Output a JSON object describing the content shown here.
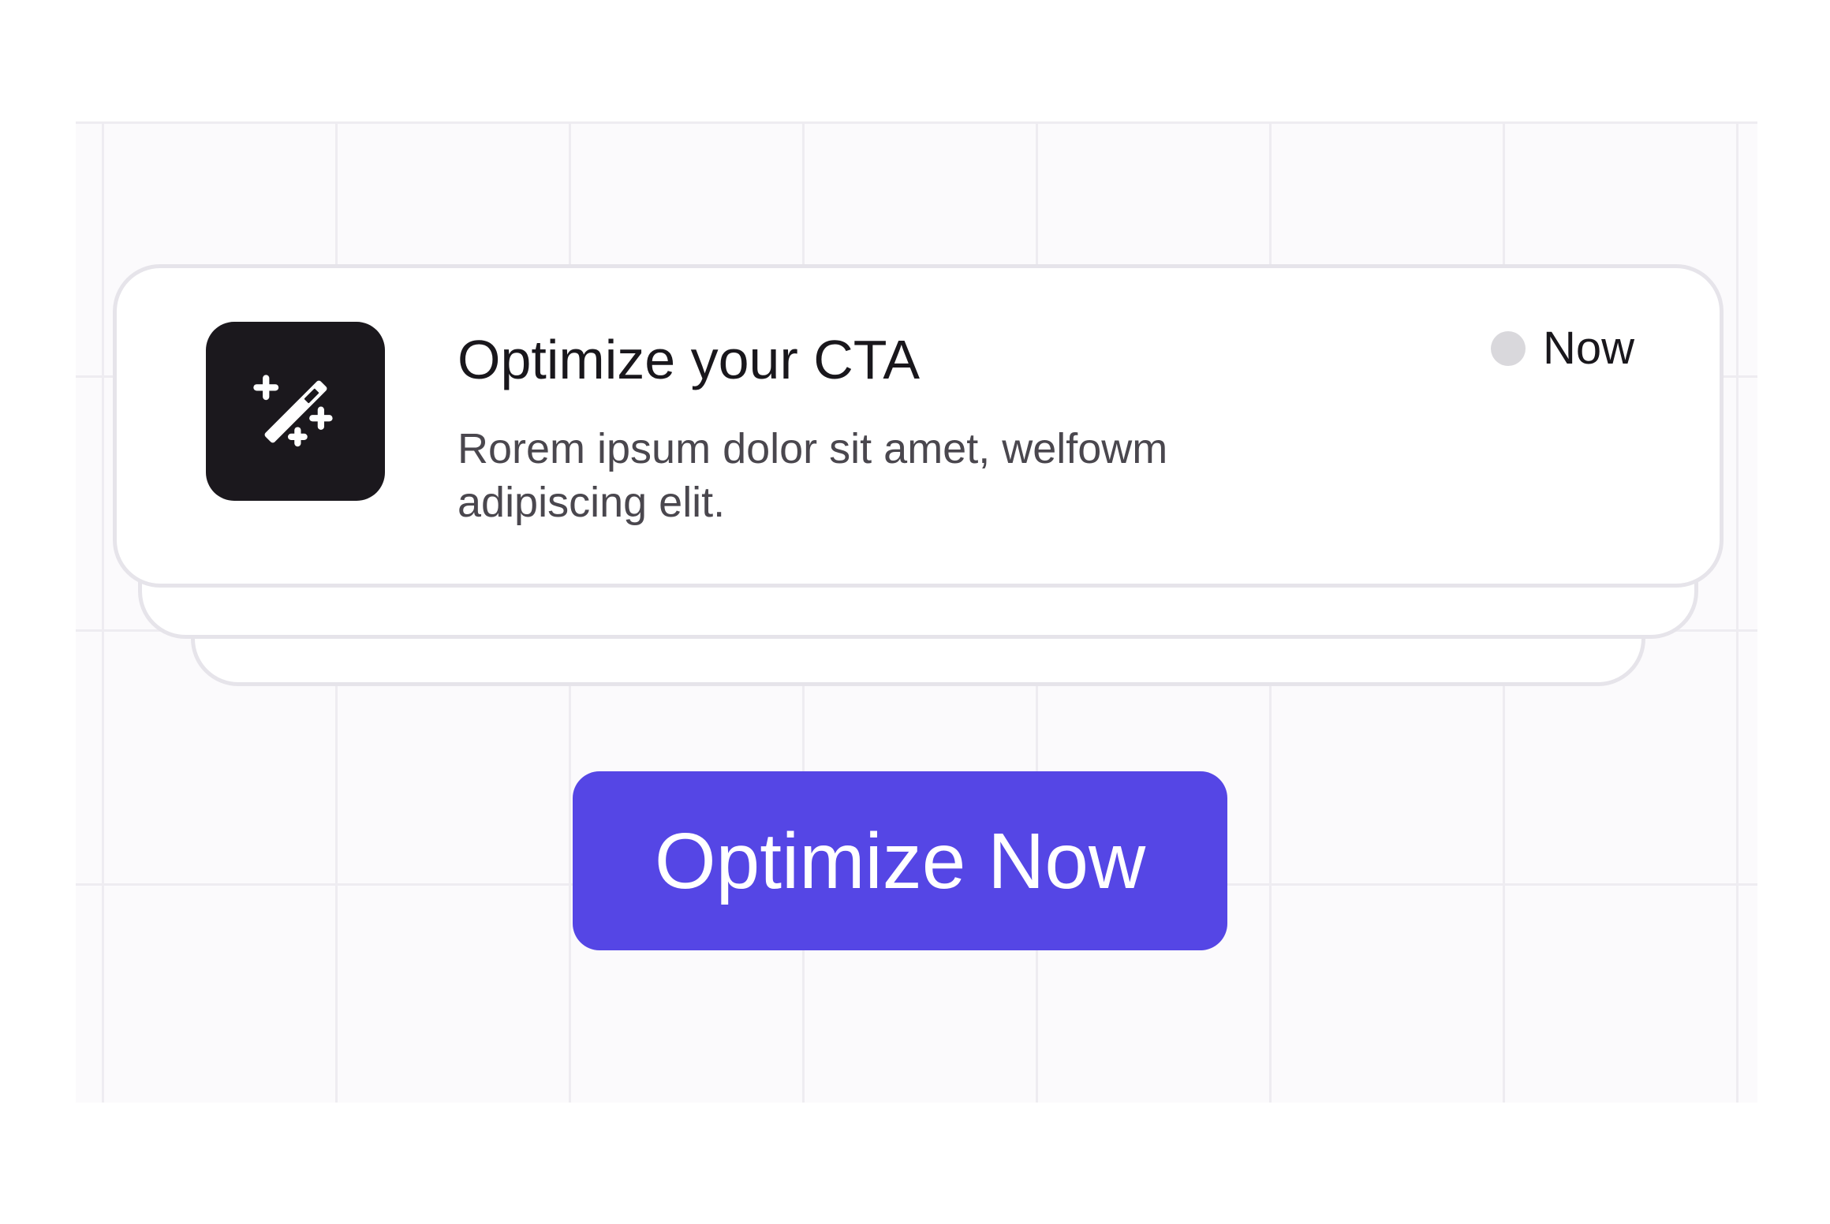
{
  "notification": {
    "title": "Optimize your CTA",
    "body": "Rorem ipsum dolor sit amet, welfowm adipiscing elit.",
    "status_label": "Now",
    "icon": "magic-wand-icon"
  },
  "cta": {
    "label": "Optimize Now"
  },
  "colors": {
    "accent": "#5546e5",
    "icon_tile": "#1b181d",
    "status_dot": "#d9d8dc"
  }
}
